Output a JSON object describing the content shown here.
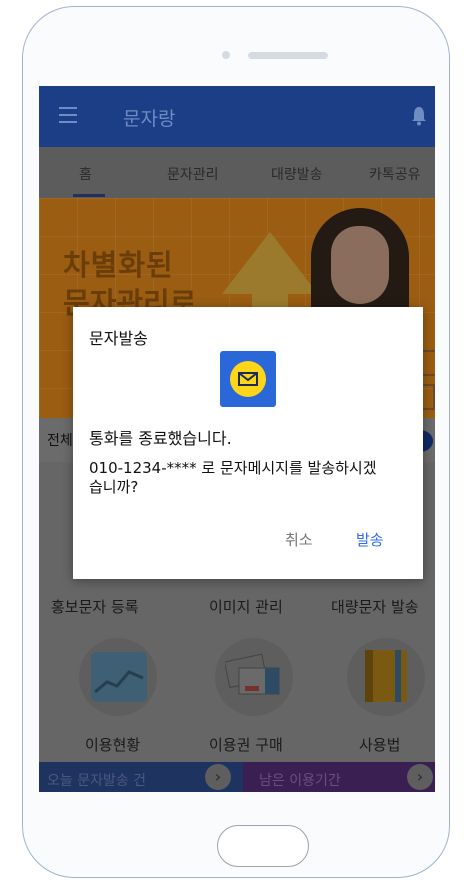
{
  "app": {
    "title": "문자랑",
    "menu_icon": "hamburger-menu-icon",
    "notification_icon": "bell-icon"
  },
  "tabs": [
    {
      "label": "홈",
      "active": true
    },
    {
      "label": "문자관리"
    },
    {
      "label": "대량발송"
    },
    {
      "label": "카톡공유"
    }
  ],
  "banner": {
    "line1": "차별화된",
    "line2": "문자관리로"
  },
  "section": {
    "label": "전체"
  },
  "menu": [
    {
      "label": "홍보문자 등록"
    },
    {
      "label": "이미지 관리"
    },
    {
      "label": "대량문자 발송"
    },
    {
      "label": "이용현황",
      "icon": "chart-icon"
    },
    {
      "label": "이용권 구매",
      "icon": "cards-icon"
    },
    {
      "label": "사용법",
      "icon": "book-icon"
    }
  ],
  "bottom": {
    "left_text": "오늘 문자발송 건",
    "right_text": "남은 이용기간"
  },
  "dialog": {
    "title": "문자발송",
    "icon": "message-envelope-icon",
    "message1": "통화를 종료했습니다.",
    "message2": "010-1234-**** 로 문자메시지를 발송하시겠습니까?",
    "cancel_label": "취소",
    "send_label": "발송"
  },
  "colors": {
    "appbar": "#1b3e86",
    "accent": "#2f6ee8",
    "icon_bg": "#2a67d8",
    "icon_fg": "#ffd51a"
  }
}
